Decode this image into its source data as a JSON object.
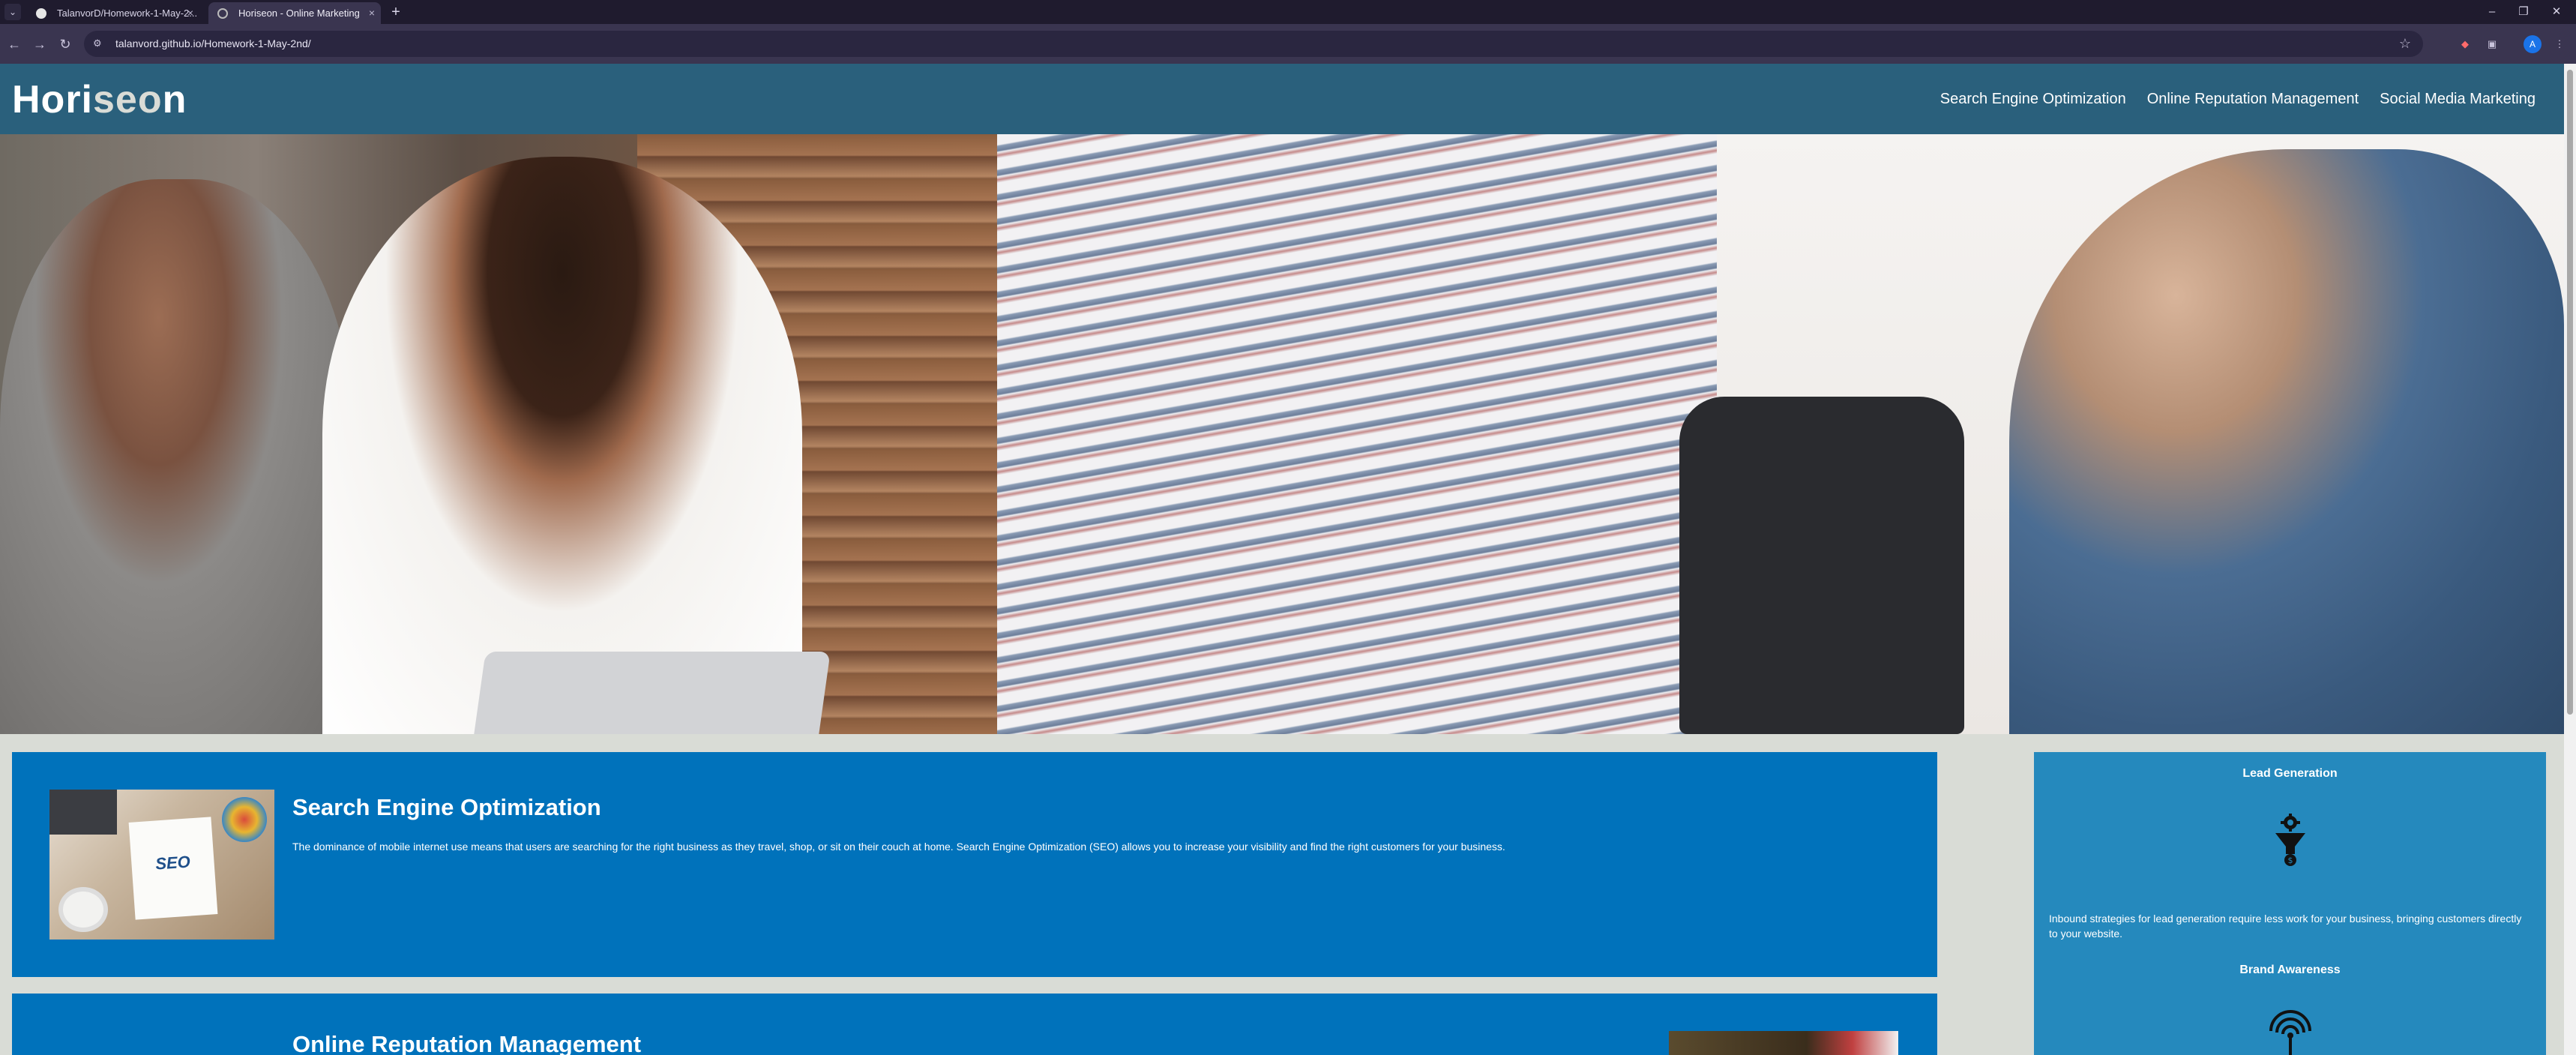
{
  "browser": {
    "tabs": [
      {
        "title": "TalanvorD/Homework-1-May-2...",
        "active": false
      },
      {
        "title": "Horiseon - Online Marketing",
        "active": true
      }
    ],
    "url": "talanvord.github.io/Homework-1-May-2nd/",
    "avatar_letter": "A"
  },
  "site": {
    "logo_main": "Hori",
    "logo_accent": "seo",
    "logo_tail": "n",
    "nav": [
      "Search Engine Optimization",
      "Online Reputation Management",
      "Social Media Marketing"
    ]
  },
  "content": {
    "seo": {
      "title": "Search Engine Optimization",
      "thumb_label": "SEO",
      "body": "The dominance of mobile internet use means that users are searching for the right business as they travel, shop, or sit on their couch at home. Search Engine Optimization (SEO) allows you to increase your visibility and find the right customers for your business."
    },
    "orm": {
      "title": "Online Reputation Management"
    }
  },
  "benefits": {
    "lead": {
      "title": "Lead Generation",
      "text": "Inbound strategies for lead generation require less work for your business, bringing customers directly to your website."
    },
    "brand": {
      "title": "Brand Awareness"
    }
  }
}
